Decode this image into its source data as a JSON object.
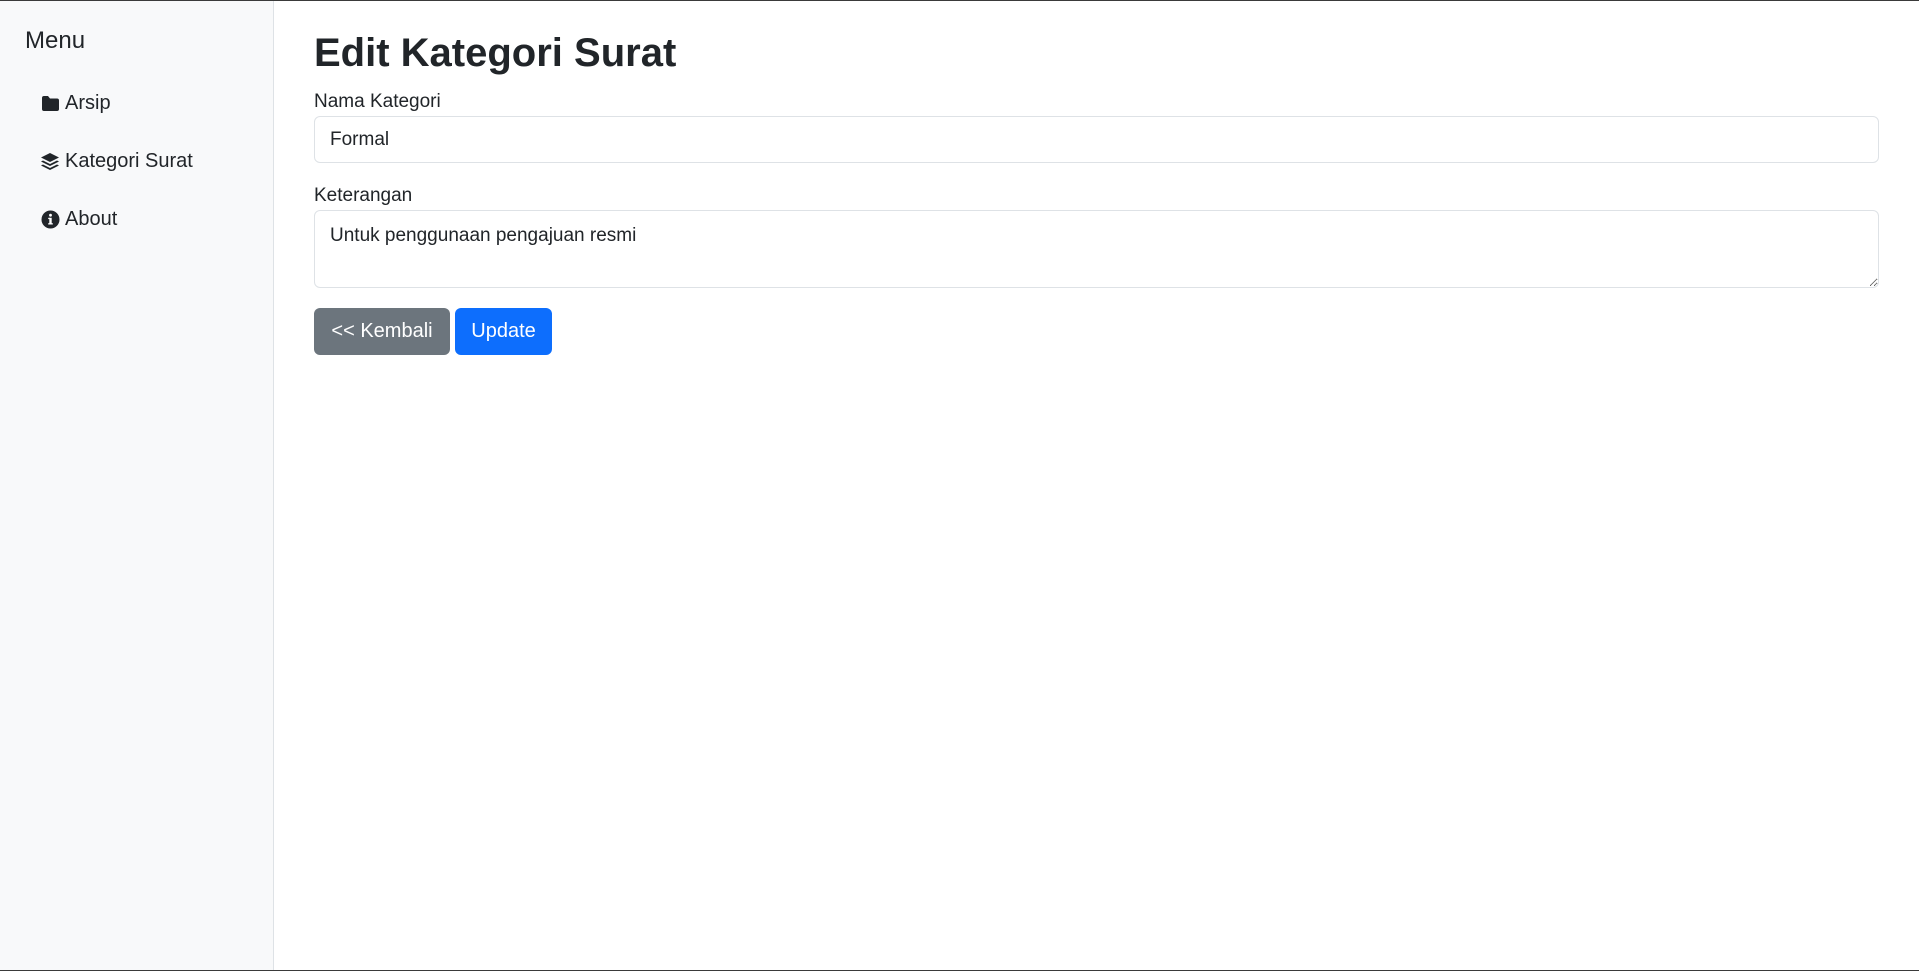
{
  "sidebar": {
    "title": "Menu",
    "items": [
      {
        "label": "Arsip",
        "icon": "folder-icon"
      },
      {
        "label": "Kategori Surat",
        "icon": "layers-icon"
      },
      {
        "label": "About",
        "icon": "info-circle-icon"
      }
    ]
  },
  "main": {
    "title": "Edit Kategori Surat",
    "fields": {
      "nama_kategori": {
        "label": "Nama Kategori",
        "value": "Formal"
      },
      "keterangan": {
        "label": "Keterangan",
        "value": "Untuk penggunaan pengajuan resmi"
      }
    },
    "buttons": {
      "back_label": "<< Kembali",
      "update_label": "Update"
    }
  },
  "colors": {
    "primary": "#0d6efd",
    "secondary": "#6c757d",
    "sidebar_bg": "#f8f9fa"
  }
}
